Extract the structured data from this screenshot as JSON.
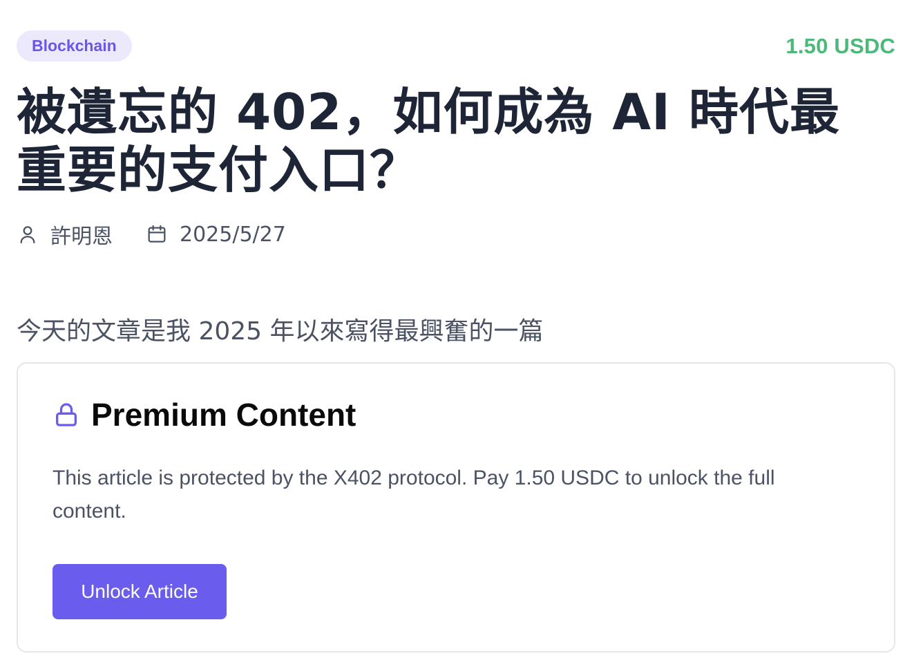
{
  "article": {
    "category": "Blockchain",
    "price": "1.50 USDC",
    "title": "被遺忘的 402，如何成為 AI 時代最重要的支付入口？",
    "author": "許明恩",
    "date": "2025/5/27",
    "summary": "今天的文章是我 2025 年以來寫得最興奮的一篇"
  },
  "paywall": {
    "title": "Premium Content",
    "description": "This article is protected by the X402 protocol. Pay 1.50 USDC to unlock the full content.",
    "button_label": "Unlock Article"
  },
  "icons": {
    "author": "user-icon",
    "date": "calendar-icon",
    "premium": "lock-icon"
  },
  "colors": {
    "accent": "#6a5ced",
    "badge_background": "#ece9fd",
    "badge_text": "#6a57e3",
    "price": "#4cb97a",
    "title": "#1e2537",
    "muted_text": "#4a5263",
    "card_border": "#e4e6ea"
  }
}
